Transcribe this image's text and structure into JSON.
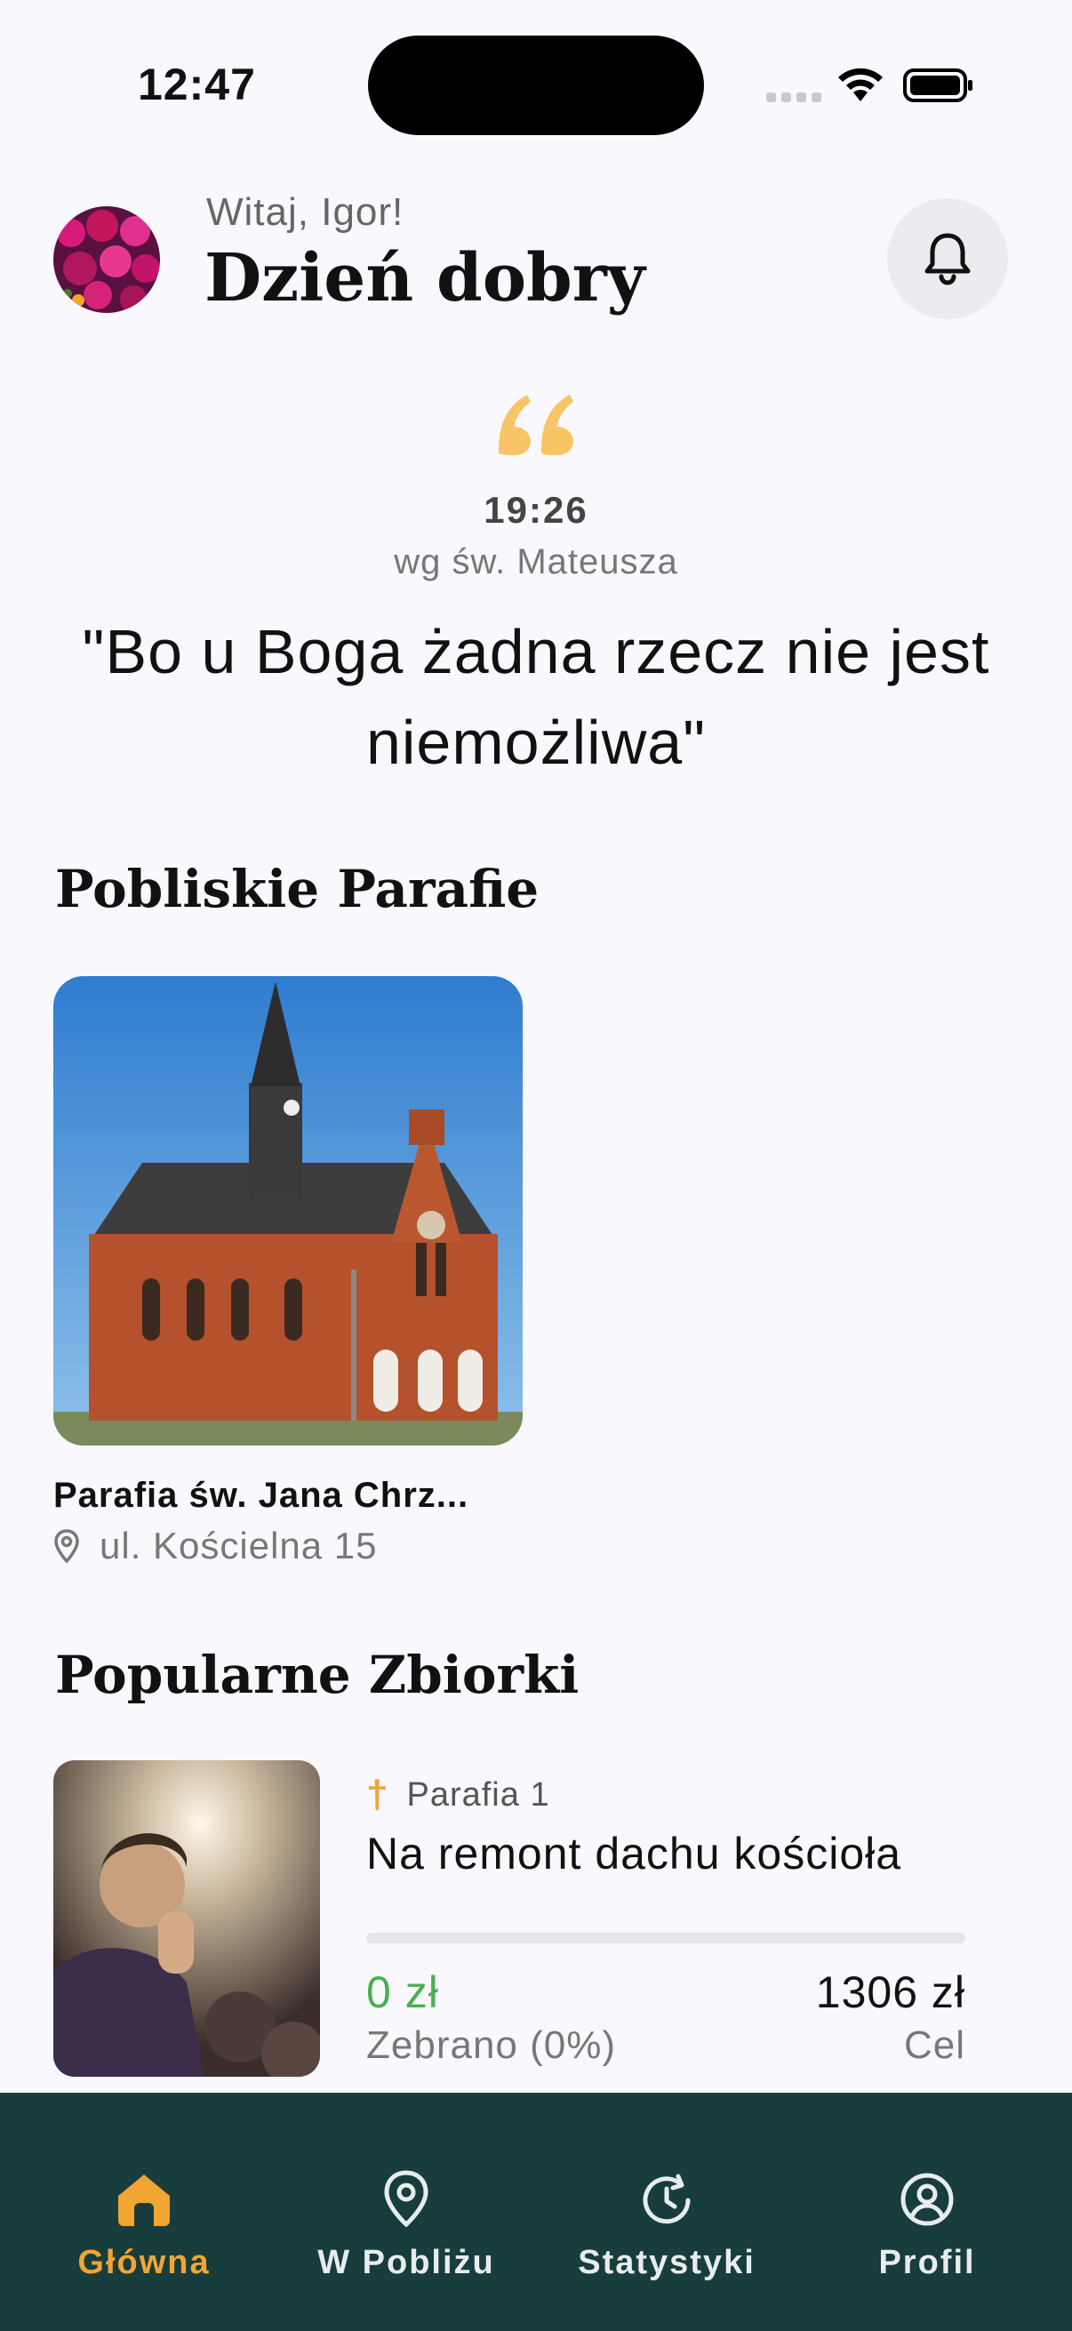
{
  "status_bar": {
    "time": "12:47"
  },
  "header": {
    "greeting": "Witaj, Igor!",
    "title": "Dzień dobry"
  },
  "verse": {
    "reference": "19:26",
    "source": "wg św. Mateusza",
    "text": "\"Bo u Boga żadna rzecz nie jest niemożliwa\""
  },
  "sections": {
    "nearby_title": "Pobliskie Parafie",
    "popular_title": "Popularne Zbiorki"
  },
  "parishes": [
    {
      "name": "Parafia św. Jana Chrz...",
      "address": "ul. Kościelna 15"
    }
  ],
  "collections": [
    {
      "parish": "Parafia 1",
      "title": "Na remont dachu kościoła",
      "raised": "0 zł",
      "raised_label": "Zebrano (0%)",
      "progress_percent": 0,
      "goal": "1306 zł",
      "goal_label": "Cel"
    }
  ],
  "nav": [
    {
      "label": "Główna",
      "icon": "home-icon",
      "active": true
    },
    {
      "label": "W Pobliżu",
      "icon": "location-pin-icon",
      "active": false
    },
    {
      "label": "Statystyki",
      "icon": "history-icon",
      "active": false
    },
    {
      "label": "Profil",
      "icon": "user-circle-icon",
      "active": false
    }
  ],
  "colors": {
    "accent": "#f2a533",
    "nav_background": "#183d3d",
    "success": "#4caf50",
    "background": "#f9f8fd"
  }
}
